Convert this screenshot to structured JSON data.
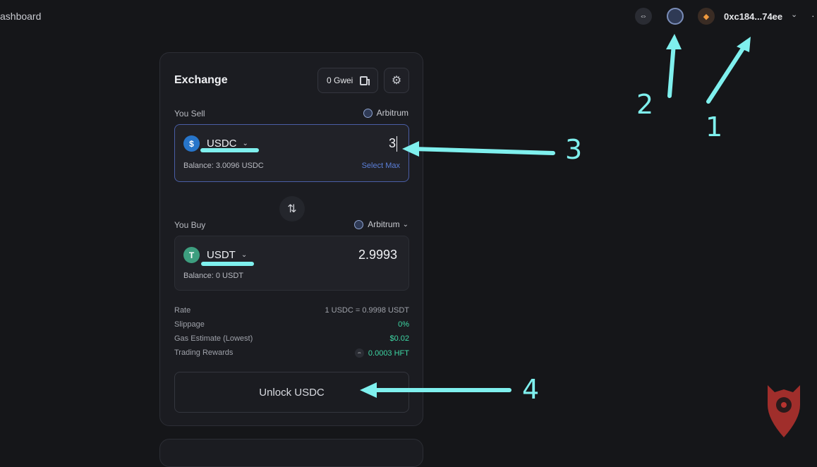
{
  "header": {
    "breadcrumb": "ashboard",
    "wallet_address": "0xc184...74ee",
    "icons": [
      "link-icon",
      "network-icon",
      "metamask-fox-icon",
      "chevron-down-icon",
      "more-icon"
    ]
  },
  "exchange": {
    "title": "Exchange",
    "gas_label": "0 Gwei",
    "sell": {
      "label": "You Sell",
      "network": "Arbitrum",
      "token": "USDC",
      "amount": "3",
      "balance": "Balance: 3.0096 USDC",
      "select_max": "Select Max"
    },
    "buy": {
      "label": "You Buy",
      "network": "Arbitrum",
      "token": "USDT",
      "amount": "2.9993",
      "balance": "Balance: 0 USDT"
    },
    "details": [
      {
        "key": "Rate",
        "value": "1 USDC = 0.9998 USDT"
      },
      {
        "key": "Slippage",
        "value": "0%"
      },
      {
        "key": "Gas Estimate (Lowest)",
        "value": "$0.02"
      },
      {
        "key": "Trading Rewards",
        "value": "0.0003 HFT"
      }
    ],
    "unlock_button": "Unlock USDC"
  },
  "annotations": {
    "numbers": [
      "1",
      "2",
      "3",
      "4"
    ],
    "color": "#7ff0ee"
  },
  "colors": {
    "background": "#151619",
    "card": "#1b1c21",
    "accent_blue": "#5b7fd8",
    "green": "#3ed6a4",
    "logo_red": "#b8332f"
  }
}
